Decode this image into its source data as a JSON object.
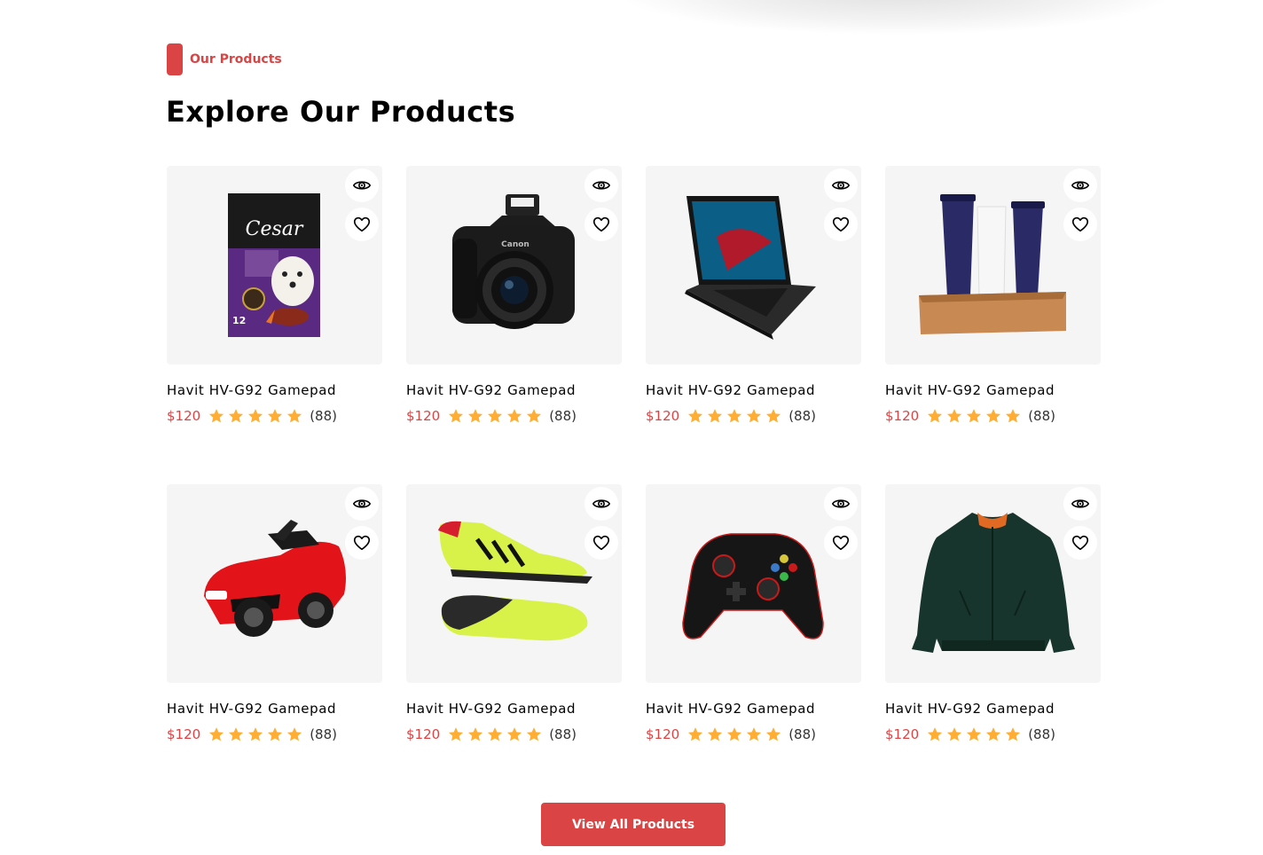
{
  "section": {
    "tag": "Our Products",
    "title": "Explore Our Products"
  },
  "colors": {
    "accent": "#DB4444",
    "star": "#FFAD33",
    "card_bg": "#F5F5F5"
  },
  "products": [
    {
      "name": "Havit HV-G92 Gamepad",
      "price": "$120",
      "rating": 5,
      "reviews": "(88)",
      "image": "dog-food-bag"
    },
    {
      "name": "Havit HV-G92 Gamepad",
      "price": "$120",
      "rating": 5,
      "reviews": "(88)",
      "image": "dslr-camera"
    },
    {
      "name": "Havit HV-G92 Gamepad",
      "price": "$120",
      "rating": 5,
      "reviews": "(88)",
      "image": "gaming-laptop"
    },
    {
      "name": "Havit HV-G92 Gamepad",
      "price": "$120",
      "rating": 5,
      "reviews": "(88)",
      "image": "skincare-set"
    },
    {
      "name": "Havit HV-G92 Gamepad",
      "price": "$120",
      "rating": 5,
      "reviews": "(88)",
      "image": "kids-electric-car"
    },
    {
      "name": "Havit HV-G92 Gamepad",
      "price": "$120",
      "rating": 5,
      "reviews": "(88)",
      "image": "soccer-cleats"
    },
    {
      "name": "Havit HV-G92 Gamepad",
      "price": "$120",
      "rating": 5,
      "reviews": "(88)",
      "image": "game-controller"
    },
    {
      "name": "Havit HV-G92 Gamepad",
      "price": "$120",
      "rating": 5,
      "reviews": "(88)",
      "image": "green-bomber-jacket"
    }
  ],
  "actions": {
    "quick_view_icon": "eye-icon",
    "wishlist_icon": "heart-icon",
    "view_all_label": "View All Products"
  }
}
